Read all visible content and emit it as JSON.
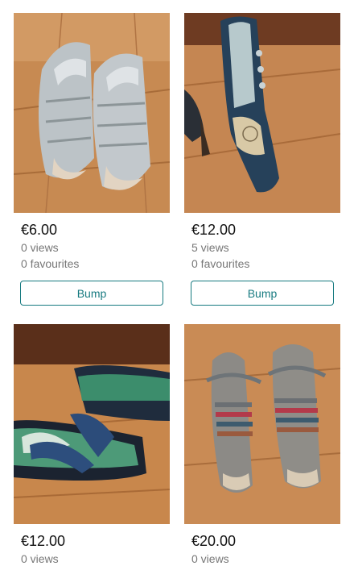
{
  "listings": [
    {
      "price": "€6.00",
      "views": "0 views",
      "favourites": "0 favourites",
      "bump_label": "Bump",
      "photo": "grey-sandals"
    },
    {
      "price": "€12.00",
      "views": "5 views",
      "favourites": "0 favourites",
      "bump_label": "Bump",
      "photo": "navy-heel-shoe"
    },
    {
      "price": "€12.00",
      "views": "0 views",
      "favourites": "",
      "bump_label": "",
      "photo": "navy-wedge-sandals"
    },
    {
      "price": "€20.00",
      "views": "0 views",
      "favourites": "",
      "bump_label": "",
      "photo": "multicolor-strap-sandals"
    }
  ],
  "colors": {
    "accent": "#177a80",
    "price_text": "#111111",
    "muted_text": "#777777",
    "wood_floor": "#c98a4f"
  }
}
